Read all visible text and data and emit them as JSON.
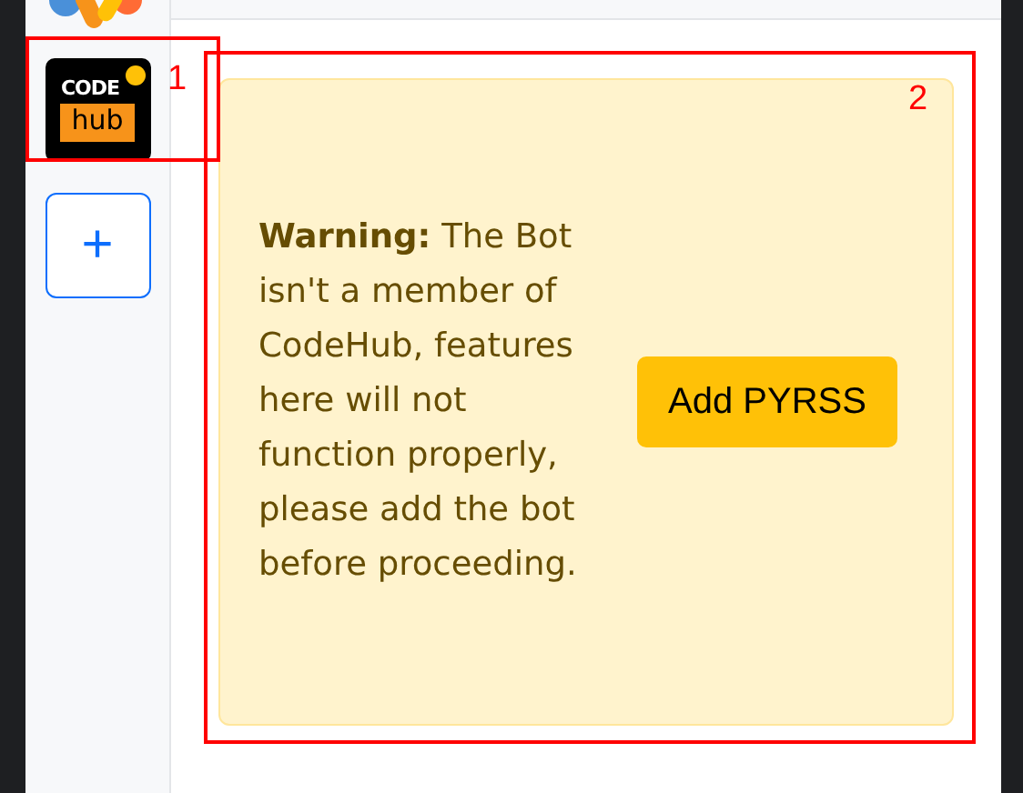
{
  "sidebar": {
    "servers": [
      {
        "logo_top": "CODE",
        "logo_bottom": "hub",
        "notification": true
      }
    ],
    "add_button": "+"
  },
  "alert": {
    "message": "**Warning:** The Bot isn't a member of CodeHub, features here will not function properly, please add the bot before proceeding.",
    "button": "Add PYRSS"
  },
  "annotations": [
    {
      "label": "1"
    },
    {
      "label": "2"
    }
  ]
}
